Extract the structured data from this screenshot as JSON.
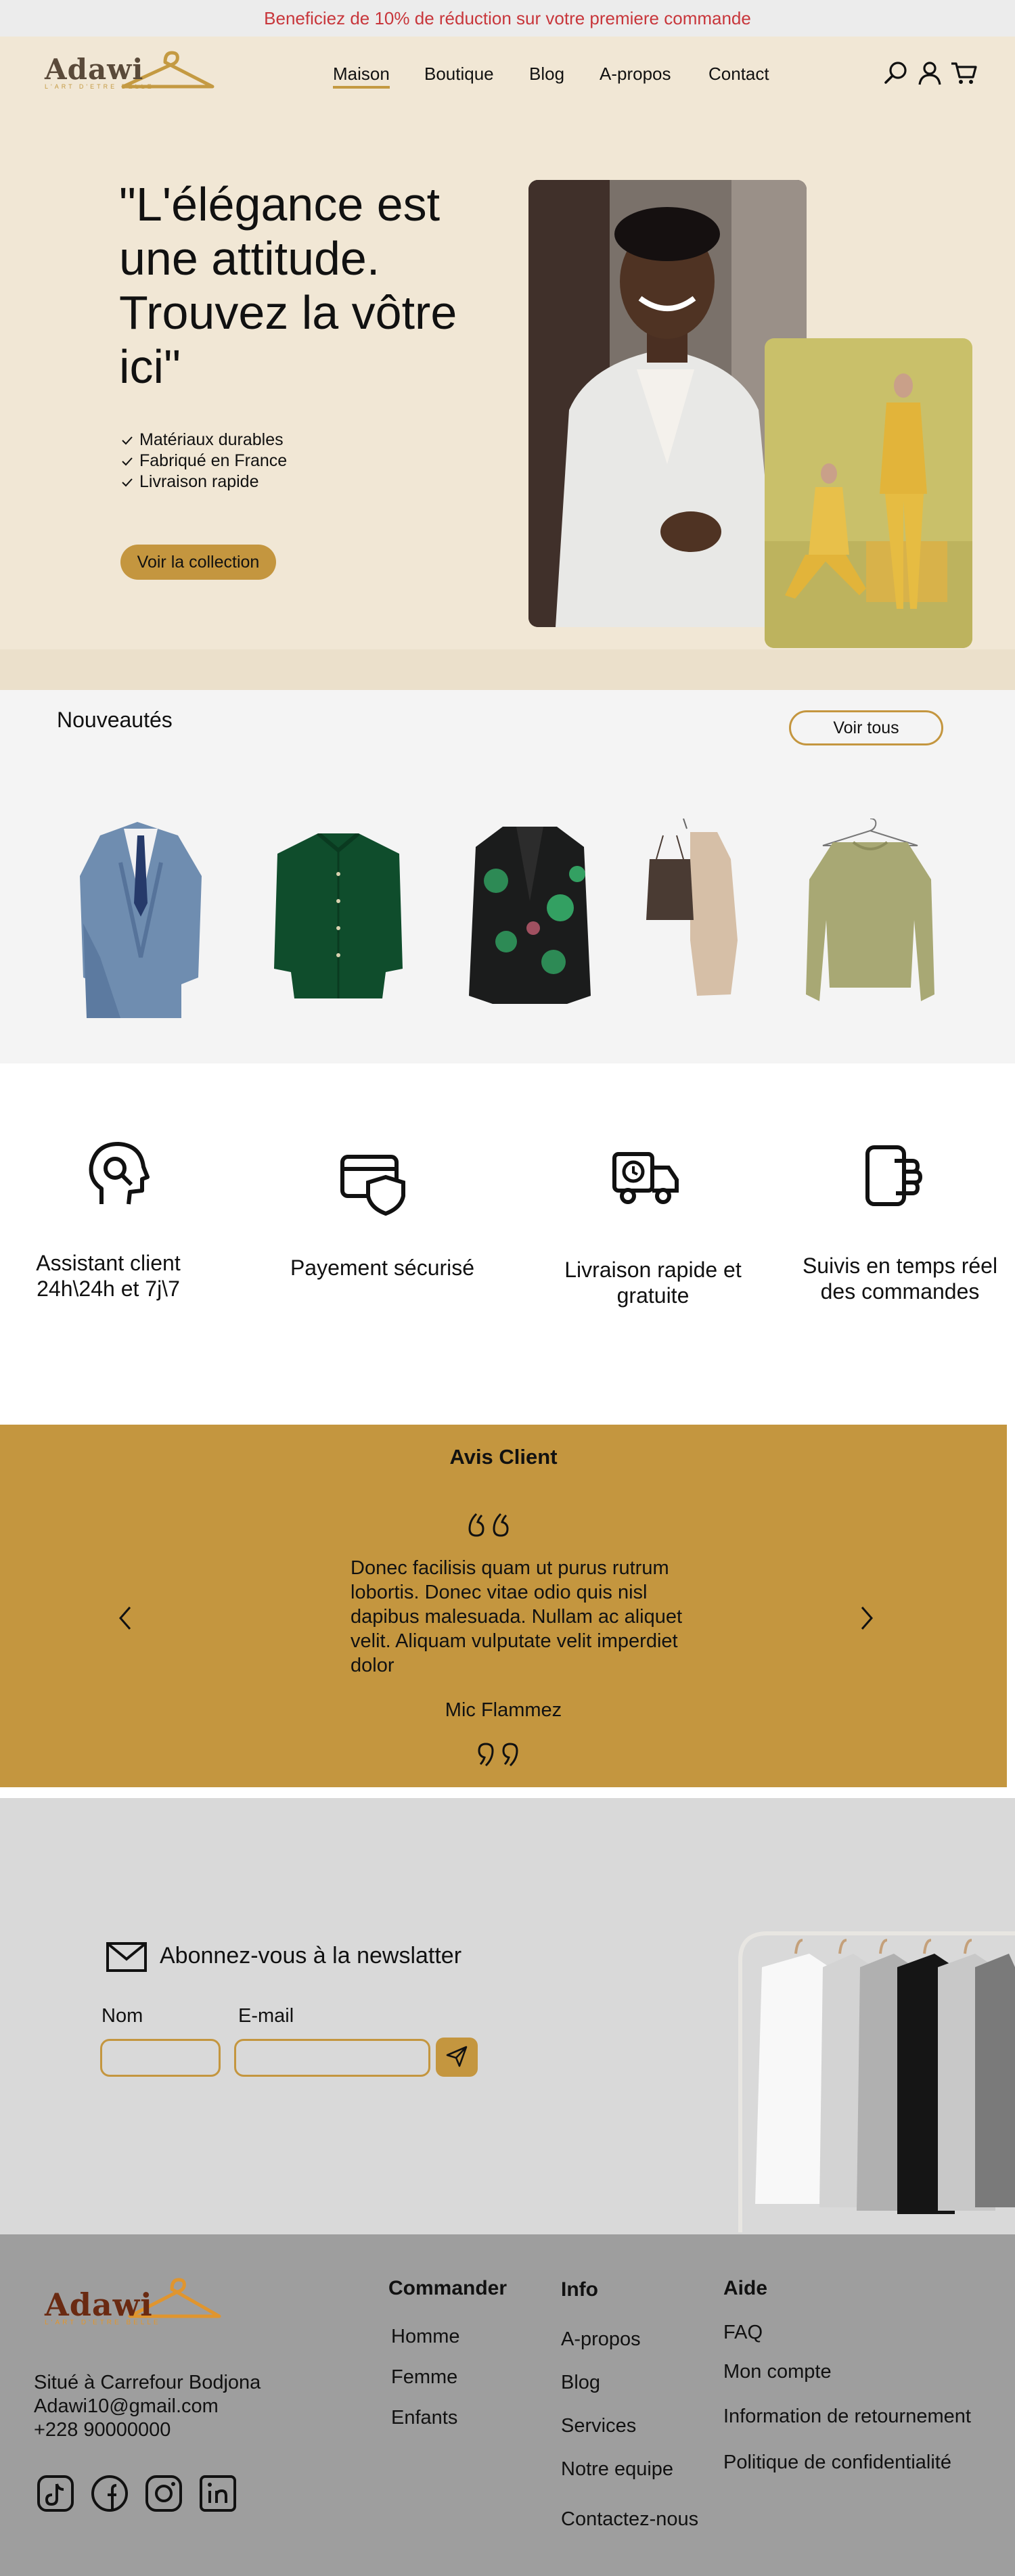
{
  "promo": {
    "text": "Beneficiez de 10% de réduction sur  votre premiere commande"
  },
  "brand": {
    "name": "Adawi",
    "tagline": "L'ART D'ETRE BELLE"
  },
  "nav": [
    {
      "label": "Maison",
      "active": true
    },
    {
      "label": "Boutique"
    },
    {
      "label": "Blog"
    },
    {
      "label": "A-propos"
    },
    {
      "label": "Contact"
    }
  ],
  "header_icons": [
    "search-icon",
    "user-icon",
    "cart-icon"
  ],
  "hero": {
    "title": "\"L'élégance est une attitude. Trouvez la vôtre ici\"",
    "features": [
      "Matériaux durables",
      "Fabriqué en France",
      "Livraison rapide"
    ],
    "cta": "Voir la collection"
  },
  "arrivals": {
    "title": "Nouveautés",
    "button": "Voir tous",
    "products": [
      "blue-three-piece-suit",
      "green-corduroy-shirt",
      "floral-blazer",
      "camisole-and-knit-dress",
      "olive-satin-blouse"
    ]
  },
  "services": [
    {
      "icon": "support-head-icon",
      "label": "Assistant  client 24h\\24h et 7j\\7"
    },
    {
      "icon": "secure-payment-icon",
      "label": "Payement sécurisé"
    },
    {
      "icon": "delivery-truck-icon",
      "label": "Livraison rapide et gratuite"
    },
    {
      "icon": "phone-tracking-icon",
      "label": "Suivis en temps réel des commandes"
    }
  ],
  "reviews": {
    "title": "Avis Client",
    "text": "Donec facilisis quam ut purus rutrum lobortis. Donec vitae odio quis nisl dapibus malesuada. Nullam ac aliquet velit. Aliquam vulputate velit imperdiet dolor",
    "author": "Mic Flammez"
  },
  "newsletter": {
    "title": "Abonnez-vous à la newslatter",
    "name_label": "Nom",
    "email_label": "E-mail"
  },
  "footer": {
    "address": "Situé à Carrefour Bodjona",
    "email": "Adawi10@gmail.com",
    "phone": "+228 90000000",
    "commander": {
      "title": "Commander",
      "links": [
        "Homme",
        "Femme",
        "Enfants"
      ]
    },
    "info": {
      "title": "Info",
      "links": [
        "A-propos",
        "Blog",
        "Services",
        "Notre equipe",
        "Contactez-nous"
      ]
    },
    "aide": {
      "title": "Aide",
      "links": [
        "FAQ",
        "Mon compte",
        "Information de retournement",
        "Politique de confidentialité"
      ]
    },
    "social": [
      "tiktok-icon",
      "facebook-icon",
      "instagram-icon",
      "linkedin-icon"
    ]
  },
  "colors": {
    "accent": "#c4963f",
    "hero_bg": "#f1e7d5",
    "promo_text": "#c8363b",
    "footer_bg": "#9e9e9e"
  }
}
